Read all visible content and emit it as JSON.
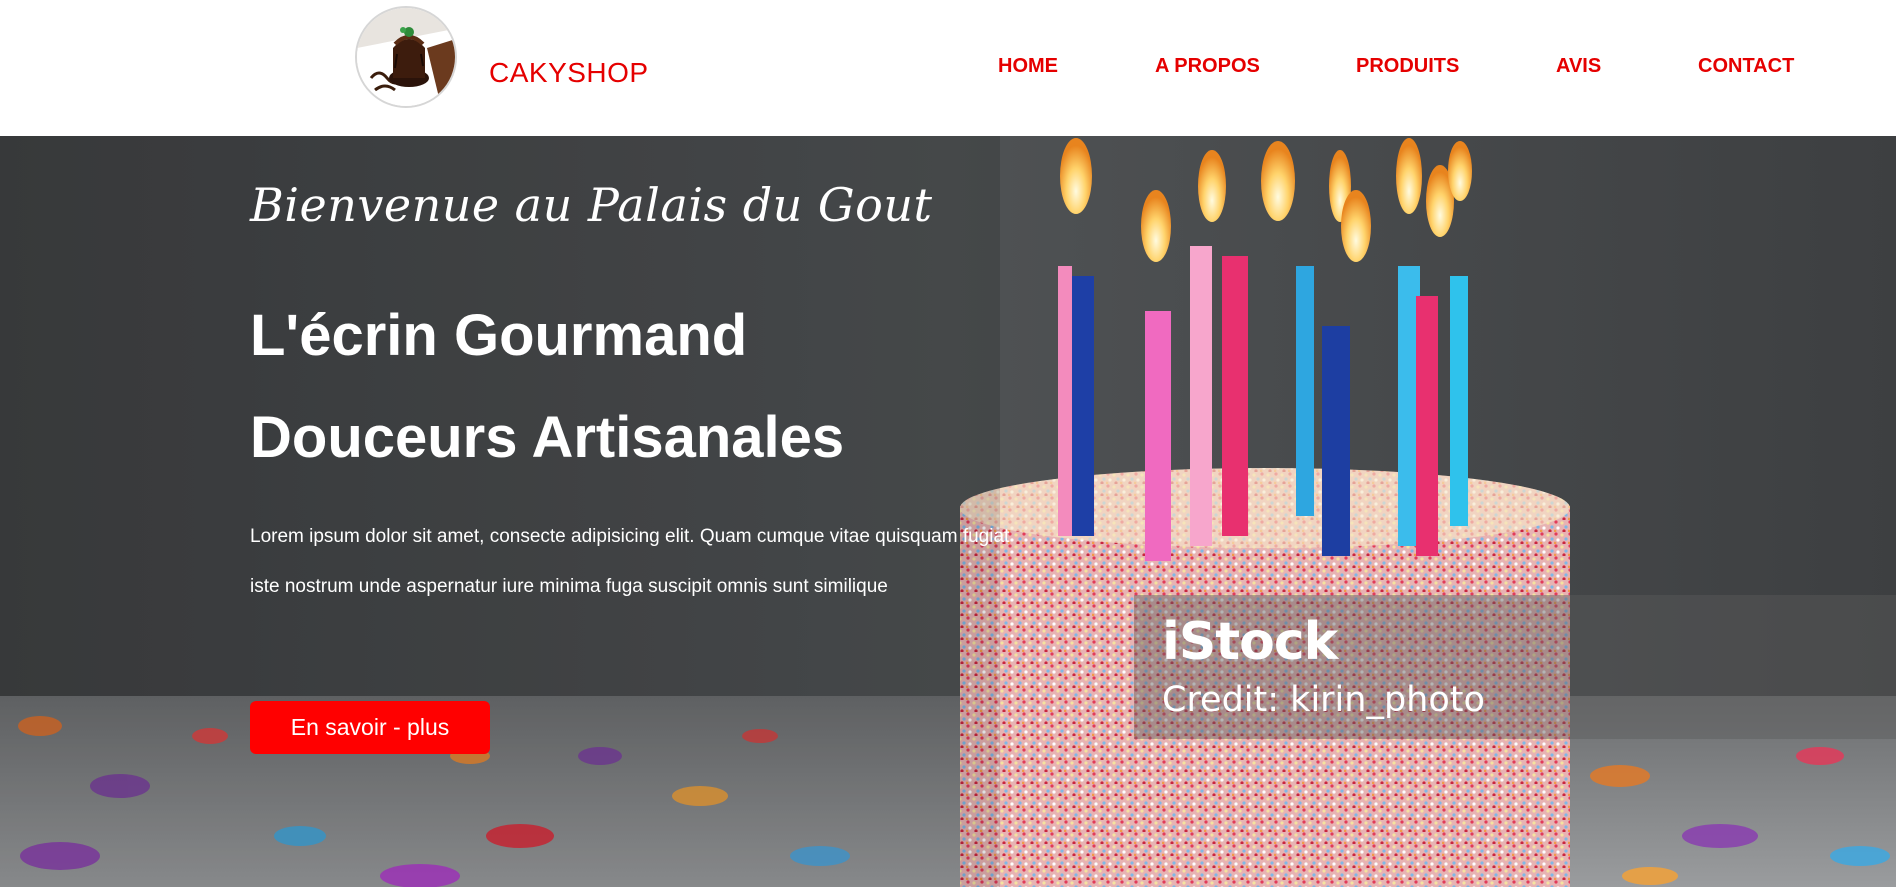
{
  "header": {
    "brand": "CAKYSHOP",
    "logo_icon": "chocolate-cake-logo-icon",
    "nav": [
      {
        "label": "HOME"
      },
      {
        "label": "A PROPOS"
      },
      {
        "label": "PRODUITS"
      },
      {
        "label": "AVIS"
      },
      {
        "label": "CONTACT"
      }
    ]
  },
  "hero": {
    "welcome": "Bienvenue au Palais du Gout",
    "title_line1": "L'écrin Gourmand",
    "title_line2": "Douceurs Artisanales",
    "description_line1": "Lorem ipsum dolor sit amet, consecte adipisicing elit. Quam cumque vitae quisquam fugiat",
    "description_line2": "iste nostrum unde aspernatur iure minima fuga suscipit omnis sunt similique",
    "cta_label": "En savoir - plus",
    "background_image": "birthday-cake-with-candles",
    "watermark": {
      "brand": "iStock",
      "credit": "Credit: kirin_photo"
    }
  },
  "colors": {
    "accent": "#e50000",
    "button": "#ff0000",
    "hero_text": "#ffffff"
  }
}
